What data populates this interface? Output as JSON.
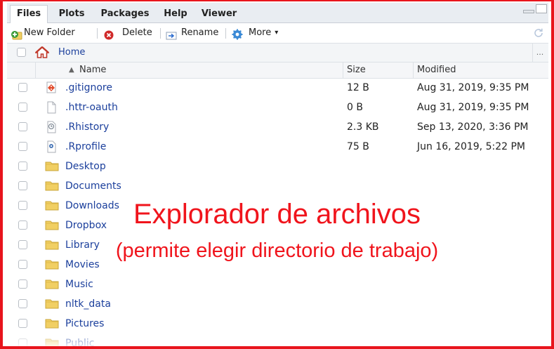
{
  "tabs": [
    {
      "label": "Files",
      "active": true
    },
    {
      "label": "Plots",
      "active": false
    },
    {
      "label": "Packages",
      "active": false
    },
    {
      "label": "Help",
      "active": false
    },
    {
      "label": "Viewer",
      "active": false
    }
  ],
  "toolbar": {
    "new_folder": "New Folder",
    "delete": "Delete",
    "rename": "Rename",
    "more": "More",
    "more_caret": "▾"
  },
  "path": {
    "home": "Home",
    "overflow": "..."
  },
  "columns": {
    "name": "Name",
    "size": "Size",
    "modified": "Modified",
    "sort_indicator": "▲"
  },
  "files": [
    {
      "name": ".gitignore",
      "size": "12 B",
      "modified": "Aug 31, 2019, 9:35 PM",
      "icon": "git-icon"
    },
    {
      "name": ".httr-oauth",
      "size": "0 B",
      "modified": "Aug 31, 2019, 9:35 PM",
      "icon": "file-icon"
    },
    {
      "name": ".Rhistory",
      "size": "2.3 KB",
      "modified": "Sep 13, 2020, 3:36 PM",
      "icon": "history-icon"
    },
    {
      "name": ".Rprofile",
      "size": "75 B",
      "modified": "Jun 16, 2019, 5:22 PM",
      "icon": "gear-file-icon"
    },
    {
      "name": "Desktop",
      "size": "",
      "modified": "",
      "icon": "folder-icon"
    },
    {
      "name": "Documents",
      "size": "",
      "modified": "",
      "icon": "folder-icon"
    },
    {
      "name": "Downloads",
      "size": "",
      "modified": "",
      "icon": "folder-icon"
    },
    {
      "name": "Dropbox",
      "size": "",
      "modified": "",
      "icon": "folder-icon"
    },
    {
      "name": "Library",
      "size": "",
      "modified": "",
      "icon": "folder-icon"
    },
    {
      "name": "Movies",
      "size": "",
      "modified": "",
      "icon": "folder-icon"
    },
    {
      "name": "Music",
      "size": "",
      "modified": "",
      "icon": "folder-icon"
    },
    {
      "name": "nltk_data",
      "size": "",
      "modified": "",
      "icon": "folder-icon"
    },
    {
      "name": "Pictures",
      "size": "",
      "modified": "",
      "icon": "folder-icon"
    },
    {
      "name": "Public",
      "size": "",
      "modified": "",
      "icon": "folder-icon"
    }
  ],
  "annotation": {
    "title": "Explorador de archivos",
    "subtitle": "(permite elegir directorio de trabajo)",
    "color": "#f0141c"
  }
}
